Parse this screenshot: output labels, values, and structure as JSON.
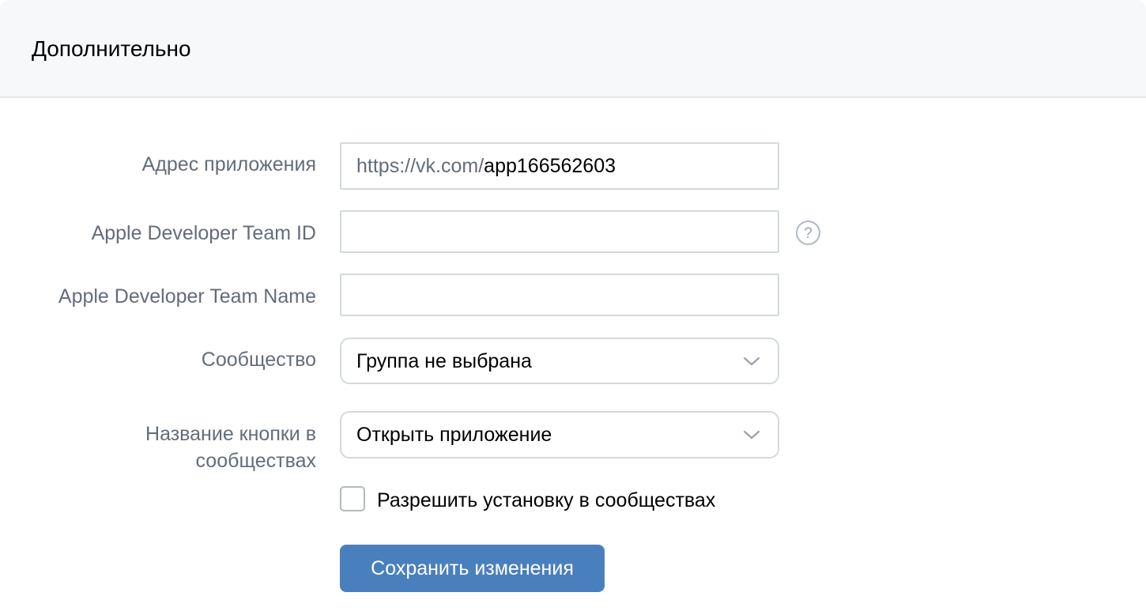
{
  "header": {
    "title": "Дополнительно"
  },
  "form": {
    "app_address": {
      "label": "Адрес приложения",
      "prefix": "https://vk.com/",
      "value": "app166562603"
    },
    "team_id": {
      "label": "Apple Developer Team ID",
      "value": "",
      "help_icon": "question-circle-icon"
    },
    "team_name": {
      "label": "Apple Developer Team Name",
      "value": ""
    },
    "community": {
      "label": "Сообщество",
      "selected": "Группа не выбрана"
    },
    "button_name": {
      "label_line1": "Название кнопки в",
      "label_line2": "сообществах",
      "selected": "Открыть приложение"
    },
    "allow_install": {
      "label": "Разрешить установку в сообществах",
      "checked": false
    },
    "save_label": "Сохранить изменения"
  },
  "colors": {
    "accent": "#4a7fbd",
    "label": "#626d7a",
    "border": "#d3d9de",
    "header_bg": "#f7f8fa"
  }
}
